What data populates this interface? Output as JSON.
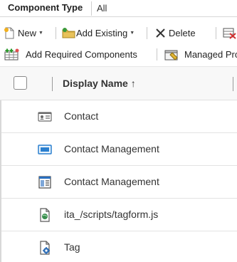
{
  "component_type": {
    "label": "Component Type",
    "value": "All"
  },
  "toolbar": {
    "new_label": "New",
    "add_existing_label": "Add Existing",
    "delete_label": "Delete",
    "add_required_label": "Add Required Components",
    "managed_label": "Managed Pro"
  },
  "grid": {
    "column_display_name": "Display Name ↑",
    "rows": [
      {
        "name": "Contact",
        "icon": "entity-card-icon"
      },
      {
        "name": "Contact Management",
        "icon": "dashboard-icon"
      },
      {
        "name": "Contact Management",
        "icon": "form-icon"
      },
      {
        "name": "ita_/scripts/tagform.js",
        "icon": "web-resource-icon"
      },
      {
        "name": "Tag",
        "icon": "plugin-assembly-icon"
      }
    ]
  }
}
